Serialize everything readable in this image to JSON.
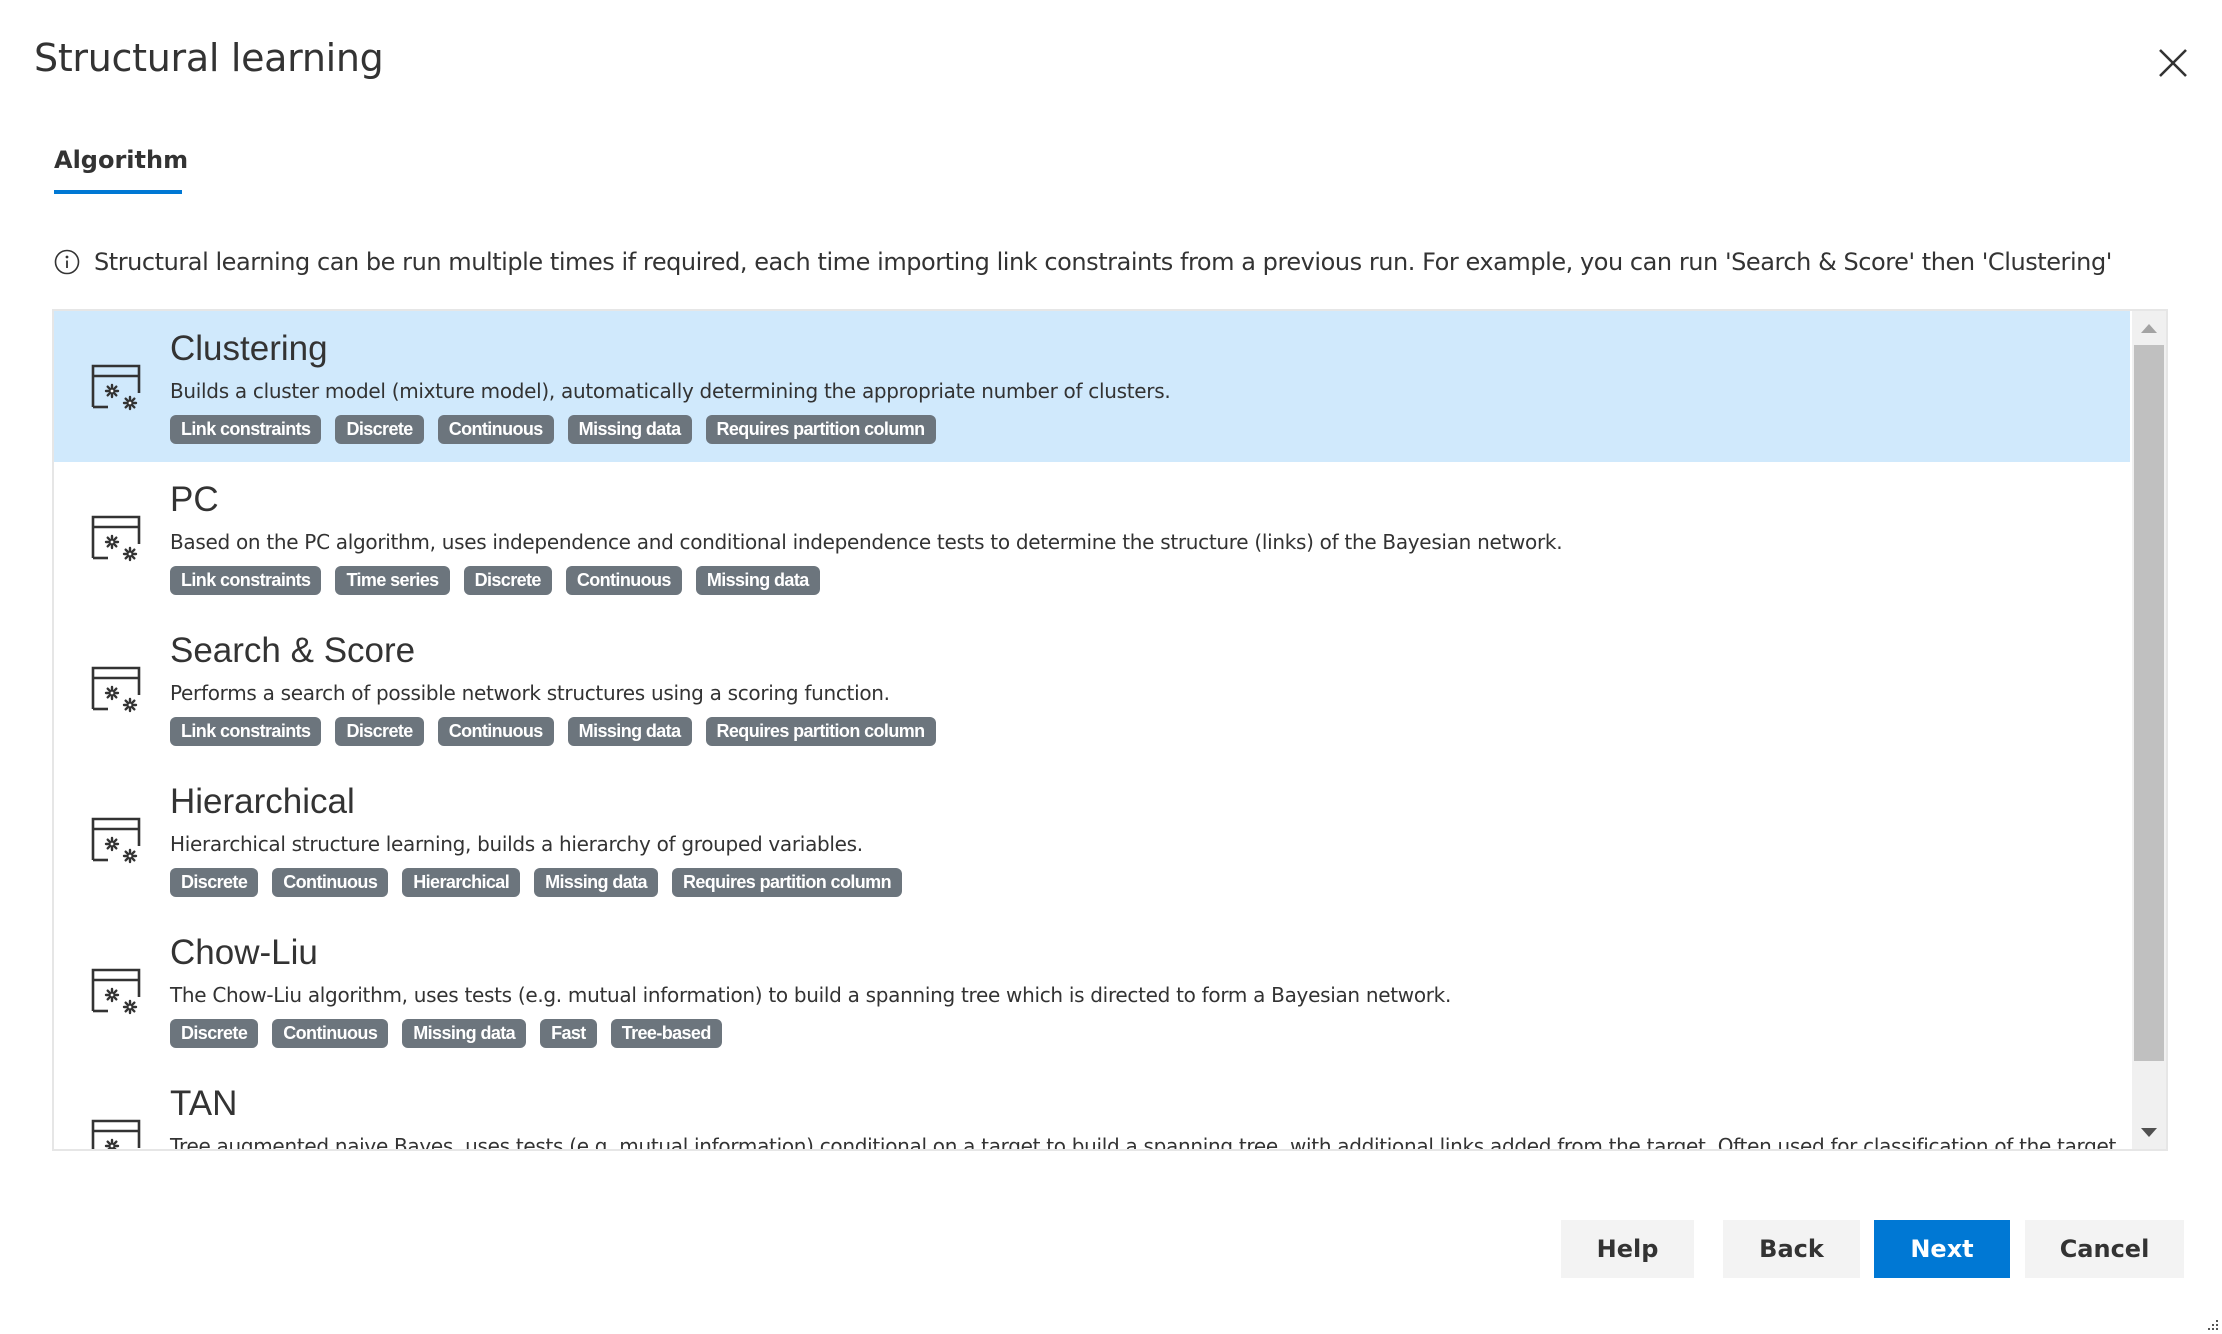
{
  "dialog": {
    "title": "Structural learning",
    "close_icon": "close-icon"
  },
  "tabs": [
    {
      "label": "Algorithm",
      "active": true
    }
  ],
  "info": {
    "icon": "info-icon",
    "text": "Structural learning can be run multiple times if required, each time importing link constraints from a previous run. For example, you can run 'Search & Score' then 'Clustering'"
  },
  "algorithms": [
    {
      "title": "Clustering",
      "description": "Builds a cluster model (mixture model), automatically determining the appropriate number of clusters.",
      "tags": [
        "Link constraints",
        "Discrete",
        "Continuous",
        "Missing data",
        "Requires partition column"
      ],
      "selected": true,
      "icon": "algorithm-settings-icon"
    },
    {
      "title": "PC",
      "description": "Based on the PC algorithm, uses independence and conditional independence tests to determine the structure (links) of the Bayesian network.",
      "tags": [
        "Link constraints",
        "Time series",
        "Discrete",
        "Continuous",
        "Missing data"
      ],
      "selected": false,
      "icon": "algorithm-settings-icon"
    },
    {
      "title": "Search & Score",
      "description": "Performs a search of possible network structures using a scoring function.",
      "tags": [
        "Link constraints",
        "Discrete",
        "Continuous",
        "Missing data",
        "Requires partition column"
      ],
      "selected": false,
      "icon": "algorithm-settings-icon"
    },
    {
      "title": "Hierarchical",
      "description": "Hierarchical structure learning, builds a hierarchy of grouped variables.",
      "tags": [
        "Discrete",
        "Continuous",
        "Hierarchical",
        "Missing data",
        "Requires partition column"
      ],
      "selected": false,
      "icon": "algorithm-settings-icon"
    },
    {
      "title": "Chow-Liu",
      "description": "The Chow-Liu algorithm, uses tests (e.g. mutual information) to build a spanning tree which is directed to form a Bayesian network.",
      "tags": [
        "Discrete",
        "Continuous",
        "Missing data",
        "Fast",
        "Tree-based"
      ],
      "selected": false,
      "icon": "algorithm-settings-icon"
    },
    {
      "title": "TAN",
      "description": "Tree augmented naive Bayes, uses tests (e.g. mutual information) conditional on a target to build a spanning tree, with additional links added from the target. Often used for classification of the target.",
      "tags": [],
      "selected": false,
      "icon": "algorithm-settings-icon"
    }
  ],
  "buttons": {
    "help": "Help",
    "back": "Back",
    "next": "Next",
    "cancel": "Cancel"
  },
  "colors": {
    "accent": "#0078d4",
    "selected_row": "#d0e9fc",
    "badge": "#6c757d",
    "button_bg": "#f3f3f3"
  }
}
